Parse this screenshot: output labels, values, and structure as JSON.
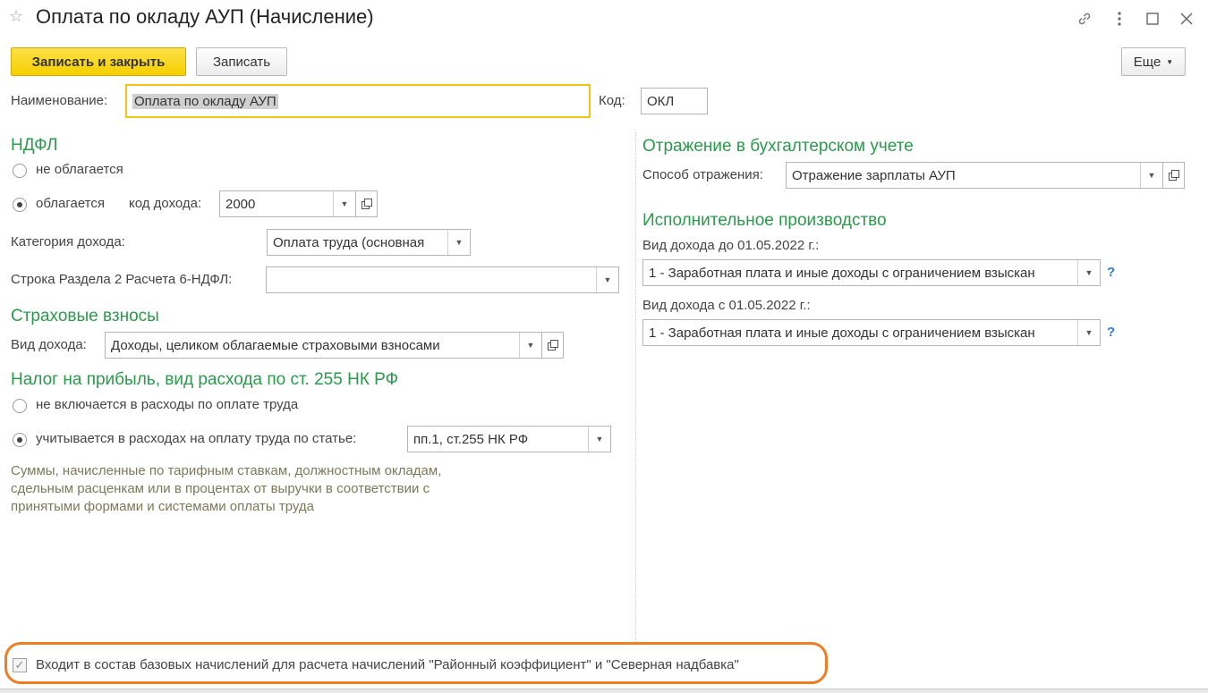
{
  "window": {
    "title": "Оплата по окладу АУП (Начисление)"
  },
  "toolbar": {
    "save_close_label": "Записать и закрыть",
    "save_label": "Записать",
    "more_label": "Еще"
  },
  "form": {
    "name_label": "Наименование:",
    "name_value": "Оплата по окладу АУП",
    "code_label": "Код:",
    "code_value": "ОКЛ"
  },
  "ndfl": {
    "heading": "НДФЛ",
    "radio_not_taxed": "не облагается",
    "radio_taxed": "облагается",
    "income_code_label": "код дохода:",
    "income_code_value": "2000",
    "income_category_label": "Категория дохода:",
    "income_category_value": "Оплата труда (основная",
    "row_label": "Строка Раздела 2 Расчета 6-НДФЛ:",
    "row_value": ""
  },
  "insurance": {
    "heading": "Страховые взносы",
    "income_type_label": "Вид дохода:",
    "income_type_value": "Доходы, целиком облагаемые страховыми взносами"
  },
  "profit_tax": {
    "heading": "Налог на прибыль, вид расхода по ст. 255 НК РФ",
    "radio_excluded": "не включается в расходы по оплате труда",
    "radio_included": "учитывается в расходах на оплату труда по статье:",
    "article_value": "пп.1, ст.255 НК РФ",
    "note": "Суммы, начисленные по тарифным ставкам, должностным окладам, сдельным расценкам или в процентах от выручки в соответствии с принятыми формами и системами оплаты труда"
  },
  "accounting": {
    "heading": "Отражение в бухгалтерском учете",
    "method_label": "Способ отражения:",
    "method_value": "Отражение зарплаты АУП"
  },
  "enforcement": {
    "heading": "Исполнительное производство",
    "before_label": "Вид дохода до 01.05.2022 г.:",
    "before_value": "1 - Заработная плата и иные доходы с ограничением взыскан",
    "after_label": "Вид дохода с 01.05.2022 г.:",
    "after_value": "1 - Заработная плата и иные доходы с ограничением взыскан",
    "help_mark": "?"
  },
  "footer": {
    "checkbox_label": "Входит в состав базовых начислений для расчета начислений \"Районный коэффициент\" и \"Северная надбавка\"",
    "checked": true
  },
  "colors": {
    "section_heading": "#2b9a4b",
    "primary_button": "#f5cf00",
    "highlight": "#ef7d22",
    "help": "#2f7fd0"
  }
}
